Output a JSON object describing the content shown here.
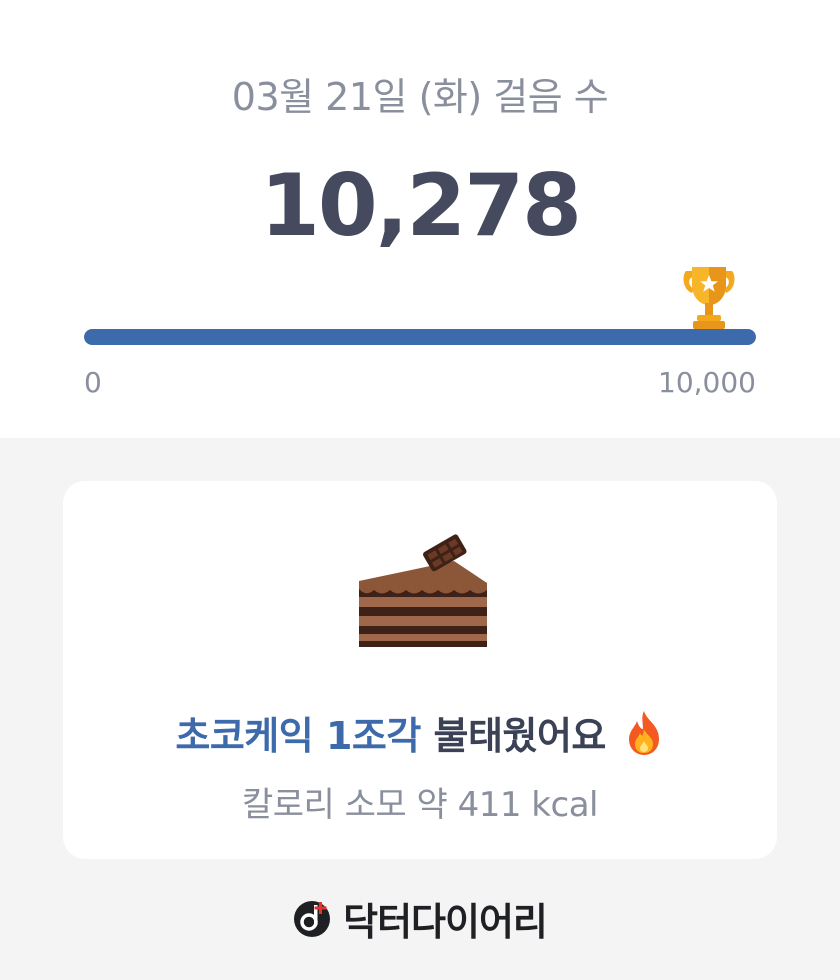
{
  "header": {
    "date_title": "03월 21일 (화) 걸음 수",
    "step_count": "10,278"
  },
  "progress": {
    "scale_min": "0",
    "scale_max": "10,000",
    "fill_percent": 100,
    "fill_color": "#3d6aaa",
    "goal_icon": "trophy-icon"
  },
  "card": {
    "food_icon": "chocolate-cake-icon",
    "headline_accent": "초코케익 1조각",
    "headline_rest": " 불태웠어요",
    "headline_icon": "fire-icon",
    "subline": "칼로리 소모 약 411 kcal"
  },
  "brand": {
    "logo_icon": "doctor-diary-logo-icon",
    "name": "닥터다이어리"
  }
}
